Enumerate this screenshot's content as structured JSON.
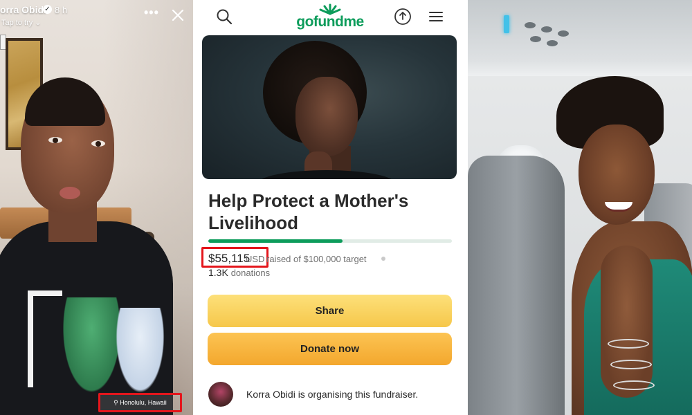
{
  "left_panel": {
    "username": "orra Obidi",
    "time": "8 h",
    "tap_to_try": "Tap to try ⌄",
    "more_label": "•••",
    "location": "⚲ Honolulu, Hawaii"
  },
  "middle_panel": {
    "logo": "gofundme",
    "campaign_title": "Help Protect a Mother's Livelihood",
    "amount_raised": "$55,115",
    "currency": "USD",
    "target_text": "raised of $100,000 target",
    "progress_fraction": 0.551,
    "donation_count": "1.3K",
    "donation_word": "donations",
    "share_label": "Share",
    "donate_label": "Donate now",
    "organiser_text": "Korra Obidi is organising this fundraiser."
  },
  "colors": {
    "brand_green": "#0d9c5b",
    "share_yellow": "#f6c74b",
    "donate_orange": "#f3a72d",
    "highlight_red": "#e4161c"
  }
}
